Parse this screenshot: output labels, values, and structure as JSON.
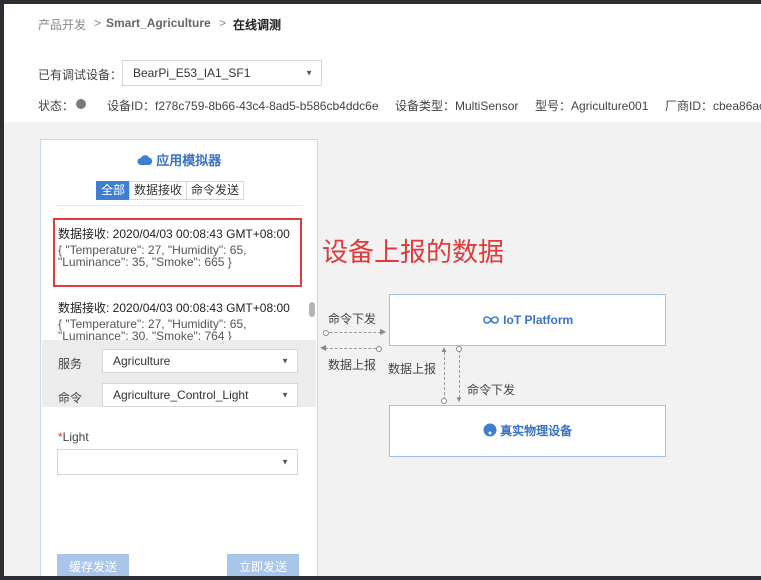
{
  "breadcrumb": {
    "item1": "产品开发",
    "item2": "Smart_Agriculture",
    "item3": "在线调测",
    "sep": ">"
  },
  "device_bar": {
    "label": "已有调试设备：",
    "selected": "BearPi_E53_IA1_SF1",
    "status_label": "状态：",
    "device_id": "设备ID：f278c759-8b66-43c4-8ad5-b586cb4ddc6e",
    "device_type": "设备类型：MultiSensor",
    "model": "型号：Agriculture001",
    "vendor": "厂商ID：cbea86ac"
  },
  "simulator": {
    "title": "应用模拟器",
    "tabs": [
      "全部",
      "数据接收",
      "命令发送"
    ],
    "messages": [
      {
        "head": "数据接收: 2020/04/03 00:08:43 GMT+08:00",
        "line1": "{ \"Temperature\": 27, \"Humidity\": 65,",
        "line2": "\"Luminance\": 35, \"Smoke\": 665 }"
      },
      {
        "head": "数据接收: 2020/04/03 00:08:43 GMT+08:00",
        "line1": "{ \"Temperature\": 27, \"Humidity\": 65,",
        "line2": "\"Luminance\": 30, \"Smoke\": 764 }"
      }
    ],
    "service_label": "服务",
    "service_value": "Agriculture",
    "command_label": "命令",
    "command_value": "Agriculture_Control_Light",
    "light_required": "*",
    "light_label": "Light",
    "light_value": "",
    "cache_send": "缓存发送",
    "send_now": "立即发送"
  },
  "annotation": "设备上报的数据",
  "diagram": {
    "platform": "IoT Platform",
    "device": "真实物理设备",
    "cmd_down_left": "命令下发",
    "data_up_left": "数据上报",
    "data_up_mid": "数据上报",
    "cmd_down_mid": "命令下发"
  },
  "colors": {
    "accent": "#3f7fd1",
    "highlight": "#e03a3a"
  }
}
